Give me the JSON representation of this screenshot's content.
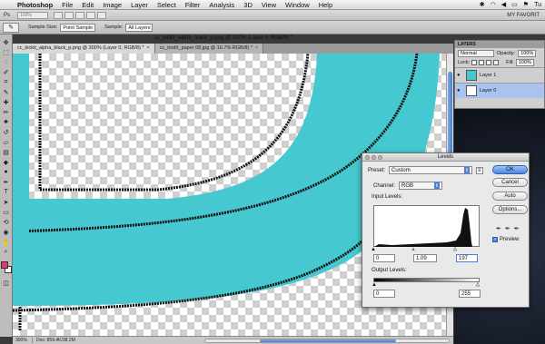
{
  "menubar": {
    "app": "Photoshop",
    "items": [
      "File",
      "Edit",
      "Image",
      "Layer",
      "Select",
      "Filter",
      "Analysis",
      "3D",
      "View",
      "Window",
      "Help"
    ],
    "right_text": "Tu"
  },
  "optbar": {
    "zoom": "100%",
    "workspace": "MY FAVORIT"
  },
  "toolopts": {
    "sample_size_label": "Sample Size:",
    "sample_size_value": "Point Sample",
    "sample_label": "Sample:",
    "sample_value": "All Layers"
  },
  "doc_title": "cc_kickit_alpha_black_p.png @ 300% (Layer 0, RGB/8) *",
  "tabs": [
    {
      "label": "cc_kickit_alpha_black_p.png @ 300% (Layer 0, RGB/8) *",
      "close": "×"
    },
    {
      "label": "cc_tooth_paper 08.jpg @ 16.7% RGB/8) *",
      "close": "×"
    }
  ],
  "status": {
    "zoom": "300%",
    "doc": "Doc: 859.4K/38.2M"
  },
  "layers_panel": {
    "title": "LAYERS",
    "blend_mode": "Normal",
    "opacity_label": "Opacity:",
    "opacity_value": "100%",
    "lock_label": "Lock:",
    "fill_label": "Fill:",
    "fill_value": "100%",
    "layers": [
      {
        "name": "Layer 1",
        "thumb": "cyan",
        "selected": false
      },
      {
        "name": "Layer 0",
        "thumb": "white",
        "selected": true
      }
    ]
  },
  "levels": {
    "title": "Levels",
    "preset_label": "Preset:",
    "preset_value": "Custom",
    "channel_label": "Channel:",
    "channel_value": "RGB",
    "input_label": "Input Levels:",
    "input_black": "0",
    "input_gamma": "1.09",
    "input_white": "197",
    "output_label": "Output Levels:",
    "output_black": "0",
    "output_white": "255",
    "buttons": {
      "ok": "OK",
      "cancel": "Cancel",
      "auto": "Auto",
      "options": "Options..."
    },
    "preview_label": "Preview",
    "preview_checked": true
  },
  "colors": {
    "cyan": "#45c8cf",
    "foreground": "#e23a6e",
    "ok_blue": "#4d87dd"
  }
}
